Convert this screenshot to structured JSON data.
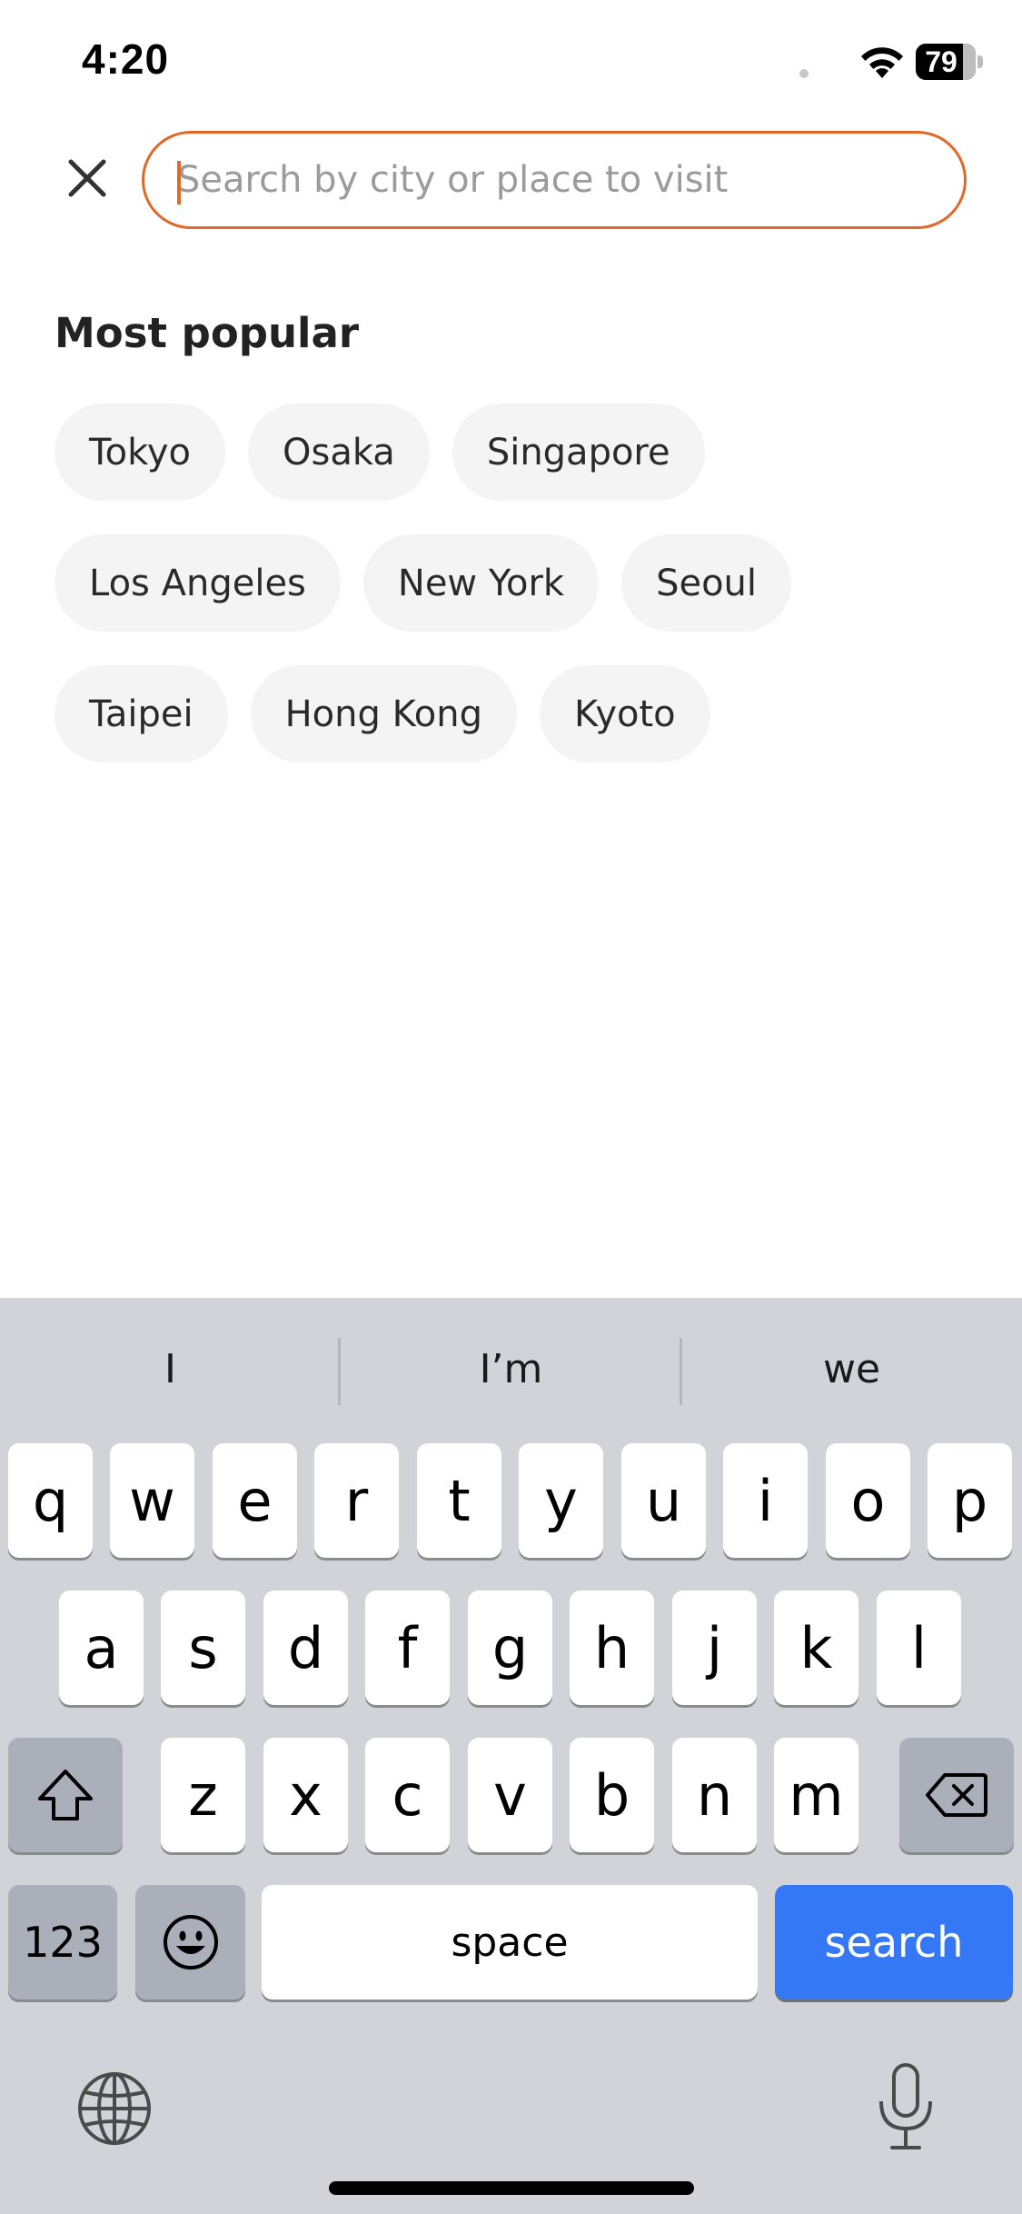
{
  "status_bar": {
    "time": "4:20",
    "battery": "79",
    "icons": [
      "wifi-icon",
      "battery-icon"
    ]
  },
  "search": {
    "placeholder": "Search by city or place to visit",
    "value": "",
    "close_icon": "close-icon",
    "accent_color": "#e0692a"
  },
  "popular": {
    "title": "Most popular",
    "cities": [
      "Tokyo",
      "Osaka",
      "Singapore",
      "Los Angeles",
      "New York",
      "Seoul",
      "Taipei",
      "Hong Kong",
      "Kyoto"
    ]
  },
  "keyboard": {
    "suggestions": [
      "I",
      "I’m",
      "we"
    ],
    "row1": [
      "q",
      "w",
      "e",
      "r",
      "t",
      "y",
      "u",
      "i",
      "o",
      "p"
    ],
    "row2": [
      "a",
      "s",
      "d",
      "f",
      "g",
      "h",
      "j",
      "k",
      "l"
    ],
    "row3": [
      "z",
      "x",
      "c",
      "v",
      "b",
      "n",
      "m"
    ],
    "numbers_label": "123",
    "space_label": "space",
    "search_label": "search",
    "icons": [
      "shift-icon",
      "delete-icon",
      "emoji-icon",
      "globe-icon",
      "microphone-icon"
    ],
    "search_key_color": "#3478f6"
  }
}
